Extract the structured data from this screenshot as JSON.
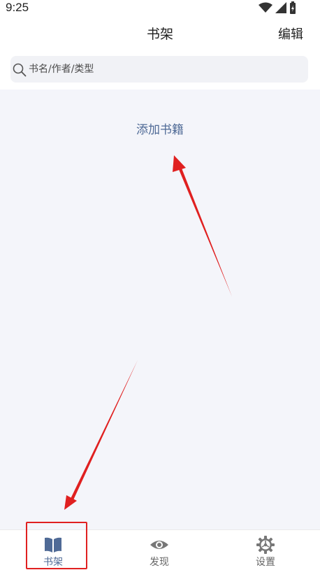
{
  "status_bar": {
    "time": "9:25"
  },
  "header": {
    "title": "书架",
    "edit_label": "编辑"
  },
  "search": {
    "placeholder": "书名/作者/类型"
  },
  "main": {
    "add_books_label": "添加书籍"
  },
  "bottom_nav": {
    "items": [
      {
        "label": "书架",
        "icon": "book-icon",
        "active": true
      },
      {
        "label": "发现",
        "icon": "eye-icon",
        "active": false
      },
      {
        "label": "设置",
        "icon": "gear-icon",
        "active": false
      }
    ]
  },
  "colors": {
    "accent": "#4f6a96",
    "content_bg": "#f4f5fa",
    "annotation_red": "#e02020"
  }
}
